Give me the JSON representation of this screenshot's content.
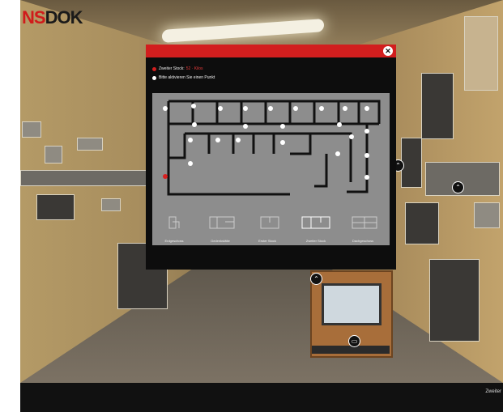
{
  "brand": {
    "logo_a": "NS",
    "logo_b": "DOK"
  },
  "modal": {
    "legend_current_label": "Zweiter Stock:",
    "legend_current_value": "52 · Kilos",
    "legend_hint": "Bitte aktivieren Sie einen Punkt",
    "close_glyph": "✕"
  },
  "floors": [
    {
      "label": "Erdgeschoss"
    },
    {
      "label": "Gedenkstätte"
    },
    {
      "label": "Erster Stock"
    },
    {
      "label": "Zweiter Stock"
    },
    {
      "label": "Dachgeschoss"
    }
  ],
  "icons": {
    "nav_up": "⌃",
    "nav_screen": "▭",
    "nav_back": "⌃"
  },
  "bottom_bar": {
    "text": "Zweiter"
  },
  "colors": {
    "accent": "#d21e1e",
    "modal_bg": "#0d0d0d",
    "map_bg": "#8d8d8d"
  }
}
